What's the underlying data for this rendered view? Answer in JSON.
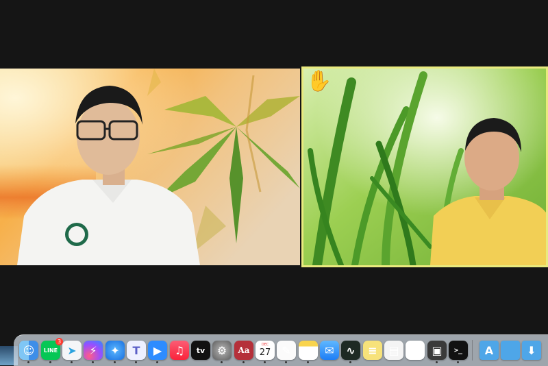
{
  "participants": [
    {
      "id": "left",
      "video": "video-feed",
      "background": "cannabis-leaf-virtual-background"
    },
    {
      "id": "right",
      "video": "video-feed",
      "background": "green-grass-virtual-background",
      "raised_hand": true,
      "active_speaker": true
    }
  ],
  "reactions": {
    "raise_hand_icon": "✋"
  },
  "dock": {
    "items": [
      {
        "name": "finder-icon",
        "label": ""
      },
      {
        "name": "line-icon",
        "label": "LINE",
        "badge": "3"
      },
      {
        "name": "telegram-icon",
        "label": ""
      },
      {
        "name": "messenger-icon",
        "label": ""
      },
      {
        "name": "safari-icon",
        "label": ""
      },
      {
        "name": "teams-icon",
        "label": ""
      },
      {
        "name": "zoom-icon",
        "label": ""
      },
      {
        "name": "music-icon",
        "label": "♫"
      },
      {
        "name": "apple-tv-icon",
        "label": "tv"
      },
      {
        "name": "system-preferences-icon",
        "label": ""
      },
      {
        "name": "dictionary-icon",
        "label": "Aa"
      },
      {
        "name": "calendar-icon",
        "label": "27",
        "month": "DEC"
      },
      {
        "name": "textedit-icon",
        "label": ""
      },
      {
        "name": "notes-icon",
        "label": ""
      },
      {
        "name": "mail-icon",
        "label": ""
      },
      {
        "name": "activity-monitor-icon",
        "label": ""
      },
      {
        "name": "stickies-icon",
        "label": ""
      },
      {
        "name": "notepad-icon",
        "label": ""
      },
      {
        "name": "reminders-icon",
        "label": ""
      },
      {
        "name": "screenshot-icon",
        "label": ""
      },
      {
        "name": "terminal-icon",
        "label": ">_"
      },
      {
        "name": "applications-folder-icon",
        "label": ""
      },
      {
        "name": "documents-folder-icon",
        "label": ""
      },
      {
        "name": "downloads-folder-icon",
        "label": ""
      }
    ]
  },
  "colors": {
    "active_speaker_border": "#e9ea7e",
    "call_background": "#151515",
    "dock_background": "#d4dee8"
  }
}
